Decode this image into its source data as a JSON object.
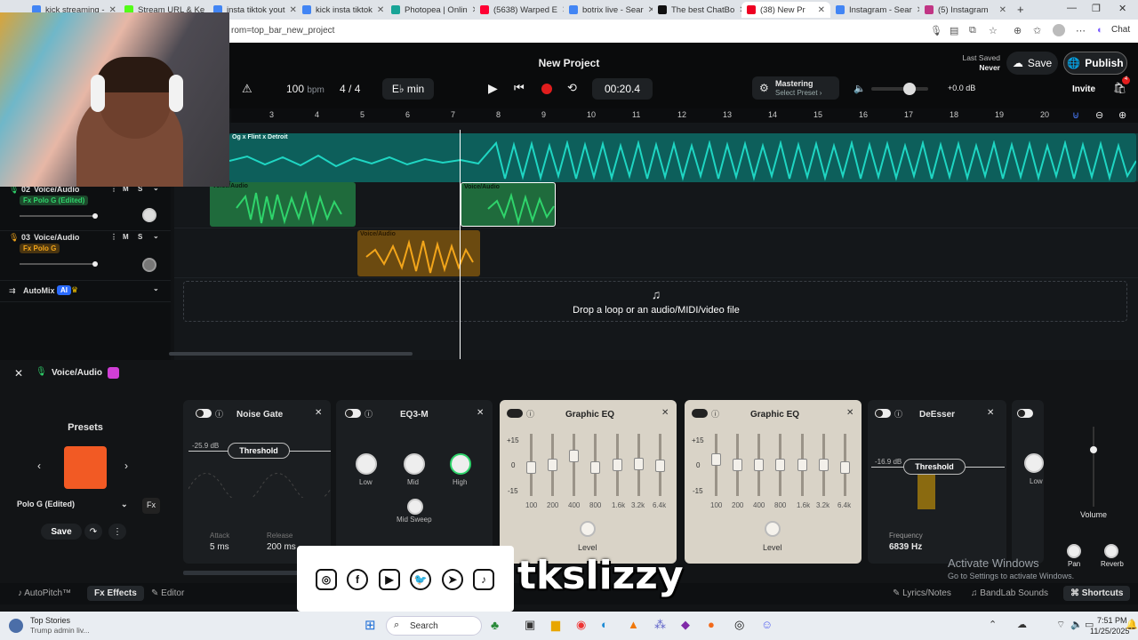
{
  "browser": {
    "tabs": [
      {
        "label": "kick streaming -",
        "color": "#4285f4"
      },
      {
        "label": "Stream URL & Ke",
        "color": "#53fc18"
      },
      {
        "label": "insta tiktok yout",
        "color": "#4285f4"
      },
      {
        "label": "kick insta tiktok",
        "color": "#4285f4"
      },
      {
        "label": "Photopea | Onlin",
        "color": "#18a497"
      },
      {
        "label": "(5638) Warped E",
        "color": "#ff0033"
      },
      {
        "label": "botrix live - Sear",
        "color": "#4285f4"
      },
      {
        "label": "The best ChatBo",
        "color": "#111"
      },
      {
        "label": "(38) New Pr",
        "color": "#e02"
      },
      {
        "label": "Instagram - Sear",
        "color": "#4285f4"
      },
      {
        "label": "(5) Instagram",
        "color": "#c13584"
      }
    ],
    "url": "rom=top_bar_new_project",
    "chat_label": "Chat"
  },
  "project": {
    "title": "New Project",
    "last_saved_label": "Last Saved",
    "last_saved_value": "Never",
    "save": "Save",
    "publish": "Publish",
    "invite": "Invite",
    "cart_badge": "4"
  },
  "transport": {
    "bpm": "100",
    "bpm_unit": "bpm",
    "time_sig_num": "4",
    "time_sig_sep": "/",
    "time_sig_den": "4",
    "key": "E♭ min",
    "time": "00:20.4",
    "mastering": "Mastering",
    "mastering_preset": "Select Preset ›",
    "volume_db": "+0.0 dB"
  },
  "ruler": [
    "3",
    "4",
    "5",
    "6",
    "7",
    "8",
    "9",
    "10",
    "11",
    "12",
    "13",
    "14",
    "15",
    "16",
    "17",
    "18",
    "19",
    "20"
  ],
  "tracks": [
    {
      "num": "02",
      "name": "Voice/Audio",
      "fx": "Fx Polo G (Edited)",
      "m": "M",
      "s": "S",
      "fx_color": "#2fd46b"
    },
    {
      "num": "03",
      "name": "Voice/Audio",
      "fx": "Fx Polo G",
      "m": "M",
      "s": "S",
      "fx_color": "#f2a51a"
    }
  ],
  "automix": {
    "label": "AutoMix",
    "badge": "AI"
  },
  "clips": {
    "beat": "Og x Flint x Detroit",
    "voice": "Voice/Audio"
  },
  "drop_text": "Drop a loop or an audio/MIDI/video file",
  "fxpanel": {
    "track": "Voice/Audio",
    "presets_title": "Presets",
    "preset_name": "Polo G (Edited)",
    "preset_save": "Save",
    "noise_gate": {
      "title": "Noise Gate",
      "threshold": "Threshold",
      "db": "-25.9 dB",
      "attack_label": "Attack",
      "attack": "5 ms",
      "release_label": "Release",
      "release": "200 ms"
    },
    "eq3m": {
      "title": "EQ3-M",
      "low": "Low",
      "mid": "Mid",
      "high": "High",
      "sweep": "Mid Sweep"
    },
    "geq": {
      "title": "Graphic EQ",
      "scale": [
        "+15",
        "0",
        "-15"
      ],
      "freqs": [
        "100",
        "200",
        "400",
        "800",
        "1.6k",
        "3.2k",
        "6.4k"
      ],
      "level": "Level",
      "levels": [
        0.45,
        0.5,
        0.68,
        0.44,
        0.5,
        0.51,
        0.49
      ]
    },
    "geq2": {
      "title": "Graphic EQ",
      "levels": [
        0.6,
        0.5,
        0.5,
        0.5,
        0.5,
        0.5,
        0.44
      ]
    },
    "deesser": {
      "title": "DeEsser",
      "db": "-16.9 dB",
      "threshold": "Threshold",
      "freq_label": "Frequency",
      "freq": "6839 Hz"
    },
    "partial_low": "Low",
    "volume": "Volume",
    "pan": "Pan",
    "reverb": "Reverb"
  },
  "bottom_tabs": {
    "autopitch": "AutoPitch™",
    "effects": "Effects",
    "editor": "Editor",
    "lyrics": "Lyrics/Notes",
    "sounds": "BandLab Sounds",
    "shortcuts": "Shortcuts"
  },
  "windows": {
    "activate": "Activate Windows",
    "activate_sub": "Go to Settings to activate Windows.",
    "news_title": "Top Stories",
    "news_sub": "Trump admin liv...",
    "search": "Search",
    "time": "7:51 PM",
    "date": "11/25/2025"
  },
  "overlay": {
    "handle": "tkslizzy"
  },
  "colors": {
    "green": "#2fd46b",
    "teal": "#1fd6c3",
    "orange": "#f2a51a",
    "record": "#e11d1d"
  }
}
